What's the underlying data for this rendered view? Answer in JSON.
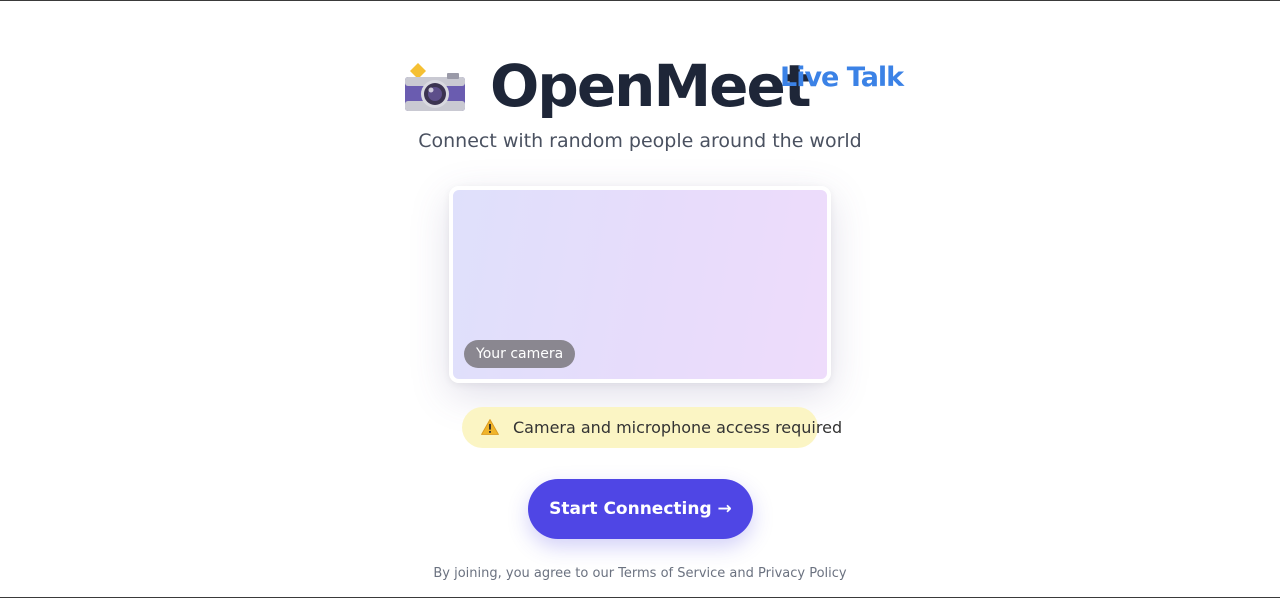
{
  "header": {
    "brand": "OpenMeet",
    "tagline": "Live Talk",
    "logo_icon": "camera-with-flash-icon"
  },
  "subtitle": "Connect with random people around the world",
  "camera_preview": {
    "label": "Your camera"
  },
  "notice": {
    "icon": "warning-icon",
    "text": "Camera and microphone access required"
  },
  "cta": {
    "label": "Start Connecting →"
  },
  "footer": {
    "prefix": "By joining, you agree to our ",
    "terms": "Terms of Service",
    "joiner": " and ",
    "privacy": "Privacy Policy"
  },
  "colors": {
    "brand_text": "#1e2638",
    "tagline": "#3b82e6",
    "cta_background": "#4f46e5",
    "notice_background": "#fbf5c4"
  }
}
